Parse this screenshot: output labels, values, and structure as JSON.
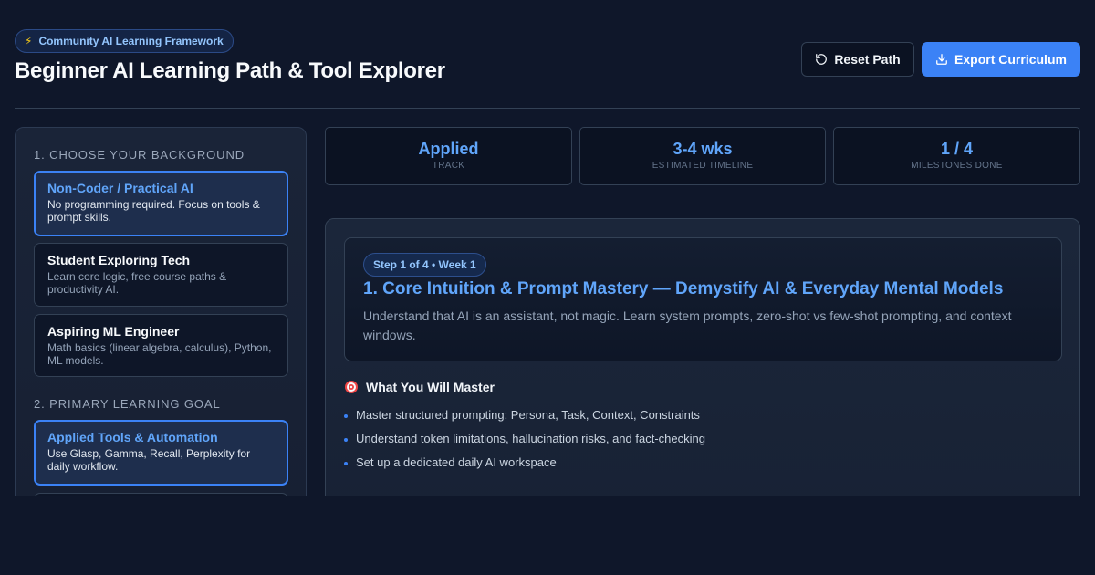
{
  "header": {
    "badge_icon": "lightning-icon",
    "badge_label": "Community AI Learning Framework",
    "title": "Beginner AI Learning Path & Tool Explorer",
    "reset_label": "Reset Path",
    "export_label": "Export Curriculum"
  },
  "sidebar": {
    "background_heading": "1. CHOOSE YOUR BACKGROUND",
    "backgrounds": [
      {
        "title": "Non-Coder / Practical AI",
        "desc": "No programming required. Focus on tools & prompt skills.",
        "selected": true
      },
      {
        "title": "Student Exploring Tech",
        "desc": "Learn core logic, free course paths & productivity AI.",
        "selected": false
      },
      {
        "title": "Aspiring ML Engineer",
        "desc": "Math basics (linear algebra, calculus), Python, ML models.",
        "selected": false
      }
    ],
    "goal_heading": "2. PRIMARY LEARNING GOAL",
    "goals": [
      {
        "title": "Applied Tools & Automation",
        "desc": "Use Glasp, Gamma, Recall, Perplexity for daily workflow.",
        "selected": true
      }
    ]
  },
  "stats": [
    {
      "value": "Applied",
      "label": "TRACK"
    },
    {
      "value": "3-4 wks",
      "label": "ESTIMATED TIMELINE"
    },
    {
      "value": "1 / 4",
      "label": "MILESTONES DONE"
    }
  ],
  "step": {
    "pill": "Step 1 of 4 • Week 1",
    "title": "1. Core Intuition & Prompt Mastery — Demystify AI & Everyday Mental Models",
    "description": "Understand that AI is an assistant, not magic. Learn system prompts, zero-shot vs few-shot prompting, and context windows."
  },
  "mastery": {
    "icon": "target-icon",
    "heading": "What You Will Master",
    "items": [
      "Master structured prompting: Persona, Task, Context, Constraints",
      "Understand token limitations, hallucination risks, and fact-checking",
      "Set up a dedicated daily AI workspace"
    ]
  },
  "colors": {
    "background": "#0f172a",
    "accent": "#3b82f6",
    "accent_text": "#60a5fa"
  }
}
